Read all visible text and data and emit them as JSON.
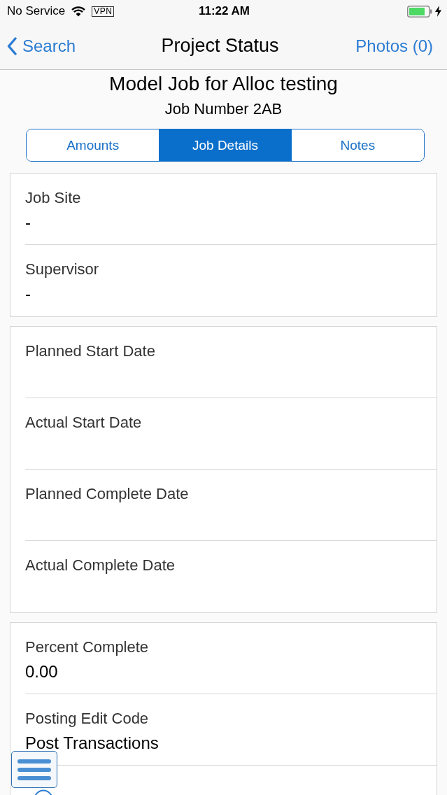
{
  "status_bar": {
    "carrier": "No Service",
    "vpn": "VPN",
    "time": "11:22 AM"
  },
  "nav_bar": {
    "back": "Search",
    "title": "Project Status",
    "action": "Photos (0)"
  },
  "header": {
    "title": "Model Job for Alloc testing",
    "subtitle": "Job Number 2AB"
  },
  "tabs": [
    {
      "label": "Amounts",
      "selected": false
    },
    {
      "label": "Job Details",
      "selected": true
    },
    {
      "label": "Notes",
      "selected": false
    }
  ],
  "sections": [
    {
      "fields": [
        {
          "kind": "text",
          "label": "Job Site",
          "value": "-"
        },
        {
          "kind": "text",
          "label": "Supervisor",
          "value": "-"
        }
      ]
    },
    {
      "fields": [
        {
          "kind": "text",
          "label": "Planned Start Date"
        },
        {
          "kind": "text",
          "label": "Actual Start Date"
        },
        {
          "kind": "text",
          "label": "Planned Complete Date"
        },
        {
          "kind": "text",
          "label": "Actual Complete Date"
        }
      ]
    },
    {
      "fields": [
        {
          "kind": "text",
          "label": "Percent Complete",
          "value": "0.00"
        },
        {
          "kind": "text",
          "label": "Posting Edit Code",
          "value": "Post Transactions"
        },
        {
          "kind": "icon"
        }
      ]
    }
  ]
}
